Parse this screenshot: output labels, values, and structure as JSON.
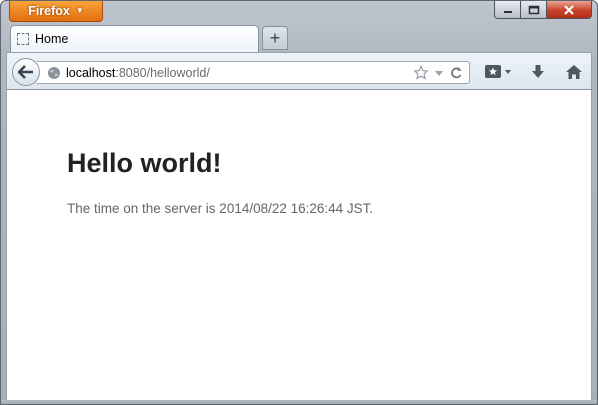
{
  "window": {
    "app_button_label": "Firefox",
    "caption_buttons": [
      "minimize-icon",
      "maximize-icon",
      "close-icon"
    ]
  },
  "tabs": [
    {
      "label": "Home",
      "active": true
    }
  ],
  "toolbar": {
    "new_tab_symbol": "+",
    "url_host": "localhost",
    "url_rest": ":8080/helloworld/"
  },
  "content": {
    "heading": "Hello world!",
    "message": "The time on the server is 2014/08/22 16:26:44 JST."
  },
  "colors": {
    "app_button": "#e46d10",
    "close_button": "#c7432a",
    "heading_text": "#222222",
    "body_text": "#666666"
  }
}
